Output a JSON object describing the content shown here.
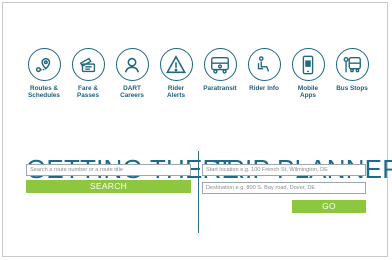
{
  "nav_tiles": [
    {
      "label": "Routes &\nSchedules",
      "icon": "map-pin-icon"
    },
    {
      "label": "Fare &\nPasses",
      "icon": "ticket-icon"
    },
    {
      "label": "DART\nCareers",
      "icon": "person-icon"
    },
    {
      "label": "Rider\nAlerts",
      "icon": "alert-icon"
    },
    {
      "label": "Paratransit",
      "icon": "paratransit-bus-icon"
    },
    {
      "label": "Rider Info",
      "icon": "seated-rider-icon"
    },
    {
      "label": "Mobile\nApps",
      "icon": "mobile-phone-icon"
    },
    {
      "label": "Bus Stops",
      "icon": "bus-stop-icon"
    }
  ],
  "getting_there": {
    "title": "GETTING THERE",
    "search_placeholder": "Search a route number or a route title",
    "search_button": "SEARCH"
  },
  "trip_planner": {
    "title": "TRIP PLANNER",
    "start_placeholder": "Start location e.g. 100 French St, Wilmington, DE",
    "destination_placeholder": "Destination e.g. 800 S. Bay road, Dover, DE",
    "go_button": "GO"
  },
  "colors": {
    "accent": "#1f6a8c",
    "icon_stroke": "#22677f",
    "button": "#8dc63f"
  }
}
